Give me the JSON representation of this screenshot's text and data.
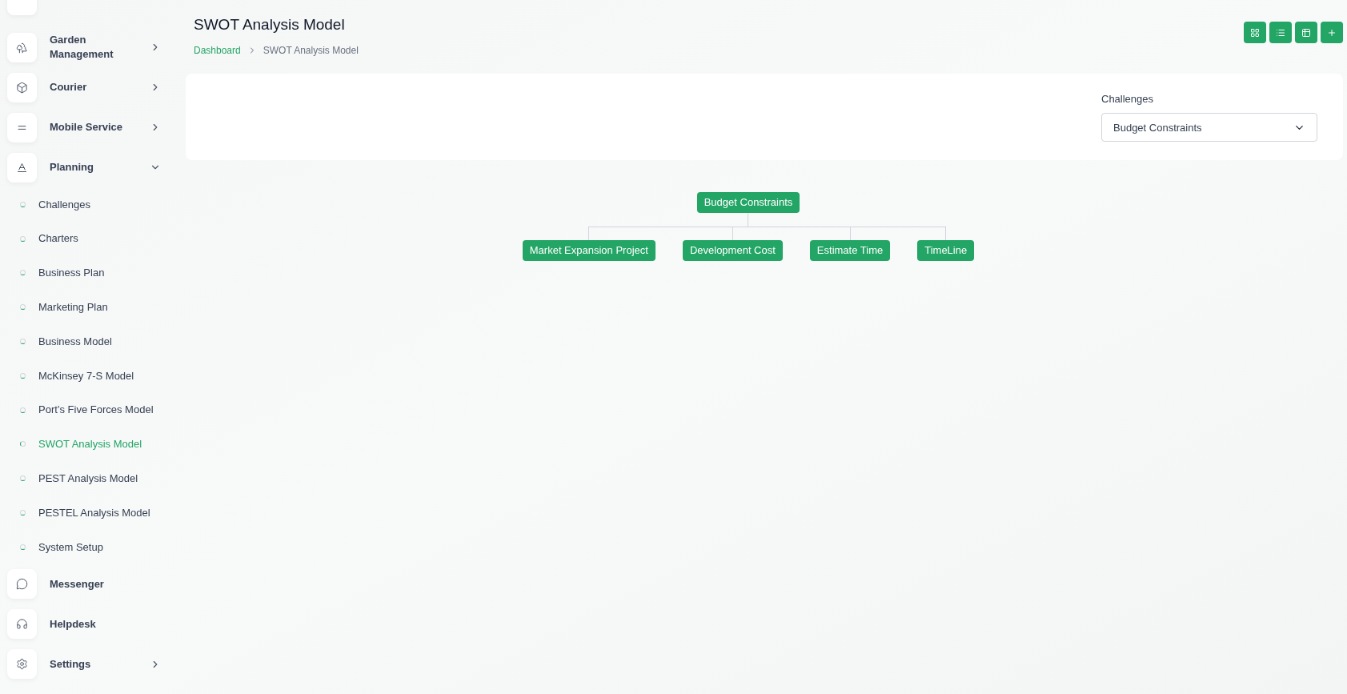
{
  "sidebar": {
    "items": [
      {
        "label": "Garden Management",
        "kind": "expandable",
        "expanded": false
      },
      {
        "label": "Courier",
        "kind": "expandable",
        "expanded": false
      },
      {
        "label": "Mobile Service",
        "kind": "expandable",
        "expanded": false
      },
      {
        "label": "Planning",
        "kind": "expandable",
        "expanded": true,
        "children": [
          {
            "label": "Challenges",
            "selected": false
          },
          {
            "label": "Charters",
            "selected": false
          },
          {
            "label": "Business Plan",
            "selected": false
          },
          {
            "label": "Marketing Plan",
            "selected": false
          },
          {
            "label": "Business Model",
            "selected": false
          },
          {
            "label": "McKinsey 7-S Model",
            "selected": false
          },
          {
            "label": "Port’s Five Forces Model",
            "selected": false
          },
          {
            "label": "SWOT Analysis Model",
            "selected": true
          },
          {
            "label": "PEST Analysis Model",
            "selected": false
          },
          {
            "label": "PESTEL Analysis Model",
            "selected": false
          },
          {
            "label": "System Setup",
            "selected": false
          }
        ]
      },
      {
        "label": "Messenger",
        "kind": "link"
      },
      {
        "label": "Helpdesk",
        "kind": "link"
      },
      {
        "label": "Settings",
        "kind": "expandable",
        "expanded": false
      }
    ]
  },
  "page": {
    "title": "SWOT Analysis Model",
    "breadcrumb": [
      "Dashboard",
      "SWOT Analysis Model"
    ]
  },
  "filter": {
    "label": "Challenges",
    "value": "Budget Constraints"
  },
  "tree": {
    "label": "Budget Constraints",
    "children": [
      {
        "label": "Market Expansion Project"
      },
      {
        "label": "Development Cost"
      },
      {
        "label": "Estimate Time"
      },
      {
        "label": "TimeLine"
      }
    ]
  }
}
